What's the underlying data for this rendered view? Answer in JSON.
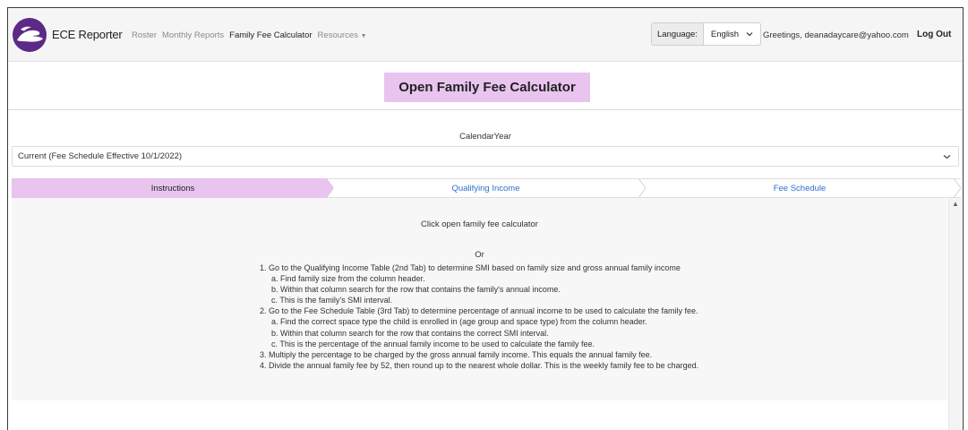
{
  "header": {
    "brand": "ECE Reporter",
    "nav": [
      {
        "label": "Roster"
      },
      {
        "label": "Monthly Reports"
      },
      {
        "label": "Family Fee Calculator"
      },
      {
        "label": "Resources"
      }
    ],
    "language_label": "Language:",
    "language_value": "English",
    "greeting": "Greetings, deanadaycare@yahoo.com",
    "logout": "Log Out"
  },
  "page_title": "Open Family Fee Calculator",
  "calendar": {
    "label": "CalendarYear",
    "value": "Current (Fee Schedule Effective 10/1/2022)"
  },
  "tabs": [
    {
      "label": "Instructions",
      "active": true
    },
    {
      "label": "Qualifying Income",
      "active": false
    },
    {
      "label": "Fee Schedule",
      "active": false
    }
  ],
  "instructions": {
    "intro": "Click open family fee calculator",
    "or": "Or",
    "lines": [
      {
        "text": "1. Go to the Qualifying Income Table (2nd Tab) to determine SMI based on family size and gross annual family income",
        "indent": false
      },
      {
        "text": "a. Find family size from the column header.",
        "indent": true
      },
      {
        "text": "b. Within that column search for the row that contains the family's annual income.",
        "indent": true
      },
      {
        "text": "c. This is the family's SMI interval.",
        "indent": true
      },
      {
        "text": "2. Go to the Fee Schedule Table (3rd Tab) to determine percentage of annual income to be used to calculate the family fee.",
        "indent": false
      },
      {
        "text": "a. Find the correct space type the child is enrolled in (age group and space type) from the column header.",
        "indent": true
      },
      {
        "text": "b. Within that column search for the row that contains the correct SMI interval.",
        "indent": true
      },
      {
        "text": "c. This is the percentage of the annual family income to be used to calculate the family fee.",
        "indent": true
      },
      {
        "text": "3. Multiply the percentage to be charged by the gross annual family income. This equals the annual family fee.",
        "indent": false
      },
      {
        "text": "4. Divide the annual family fee by 52, then round up to the nearest whole dollar. This is the weekly family fee to be charged.",
        "indent": false
      }
    ]
  },
  "colors": {
    "accent": "#e8c4ef",
    "logo": "#5b2a86",
    "link": "#2f6fd0"
  }
}
